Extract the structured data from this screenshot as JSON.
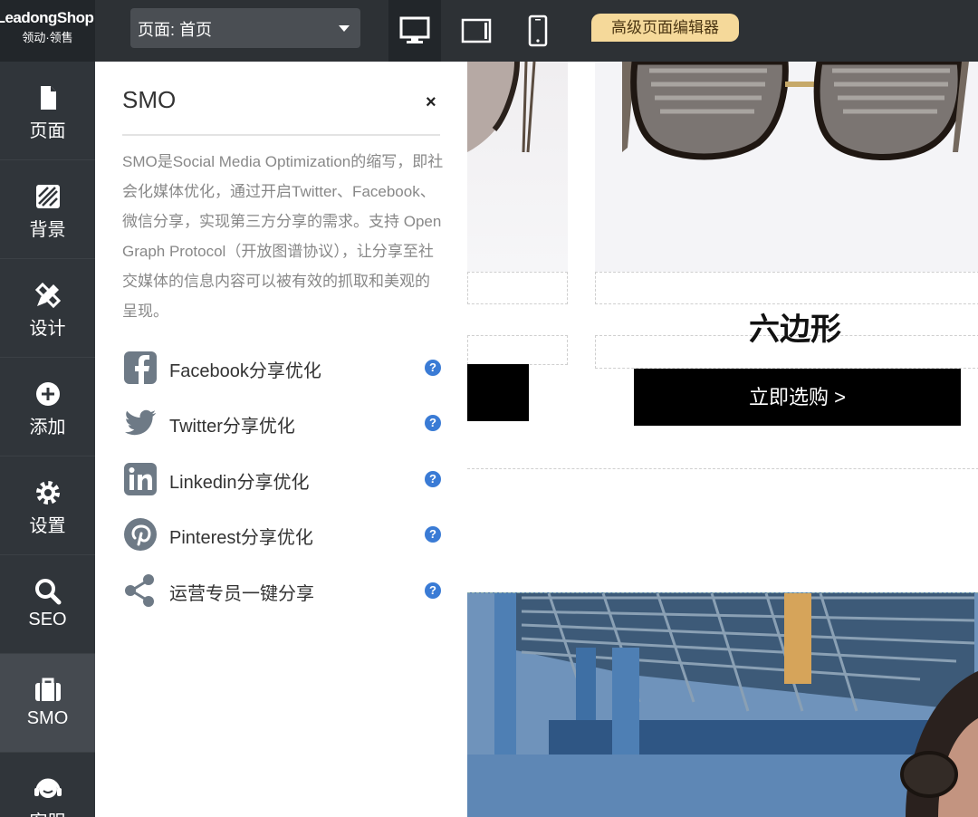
{
  "logo": {
    "line1": "LeadongShop",
    "line2": "领动·领售"
  },
  "header": {
    "page_select": "页面:  首页",
    "device_desktop_icon": "monitor-icon",
    "device_tablet_icon": "tablet-icon",
    "device_mobile_icon": "phone-icon",
    "advanced_editor": "高级页面编辑器"
  },
  "sidenav": {
    "items": [
      {
        "label": "页面",
        "icon": "file-icon"
      },
      {
        "label": "背景",
        "icon": "stripes-icon"
      },
      {
        "label": "设计",
        "icon": "design-icon"
      },
      {
        "label": "添加",
        "icon": "plus-circle-icon"
      },
      {
        "label": "设置",
        "icon": "gear-icon"
      },
      {
        "label": "SEO",
        "icon": "search-icon"
      },
      {
        "label": "SMO",
        "icon": "briefcase-icon"
      },
      {
        "label": "客服",
        "icon": "headset-icon"
      }
    ],
    "active": "SMO"
  },
  "panel": {
    "title": "SMO",
    "close": "×",
    "description": "SMO是Social Media Optimization的缩写，即社会化媒体优化，通过开启Twitter、Facebook、微信分享，实现第三方分享的需求。支持 Open Graph Protocol（开放图谱协议），让分享至社交媒体的信息内容可以被有效的抓取和美观的呈现。",
    "options": [
      {
        "label": "Facebook分享优化",
        "icon": "facebook-icon"
      },
      {
        "label": "Twitter分享优化",
        "icon": "twitter-icon"
      },
      {
        "label": "Linkedin分享优化",
        "icon": "linkedin-icon"
      },
      {
        "label": "Pinterest分享优化",
        "icon": "pinterest-icon"
      },
      {
        "label": "运营专员一键分享",
        "icon": "share-icon"
      }
    ],
    "help": "?"
  },
  "canvas": {
    "product_name": "六边形",
    "buy_button": "立即选购 >"
  },
  "colors": {
    "topbar": "#2d3135",
    "sidenav": "#30353a",
    "accent_gold": "#f5d99a",
    "help_blue": "#3a7bd5"
  }
}
